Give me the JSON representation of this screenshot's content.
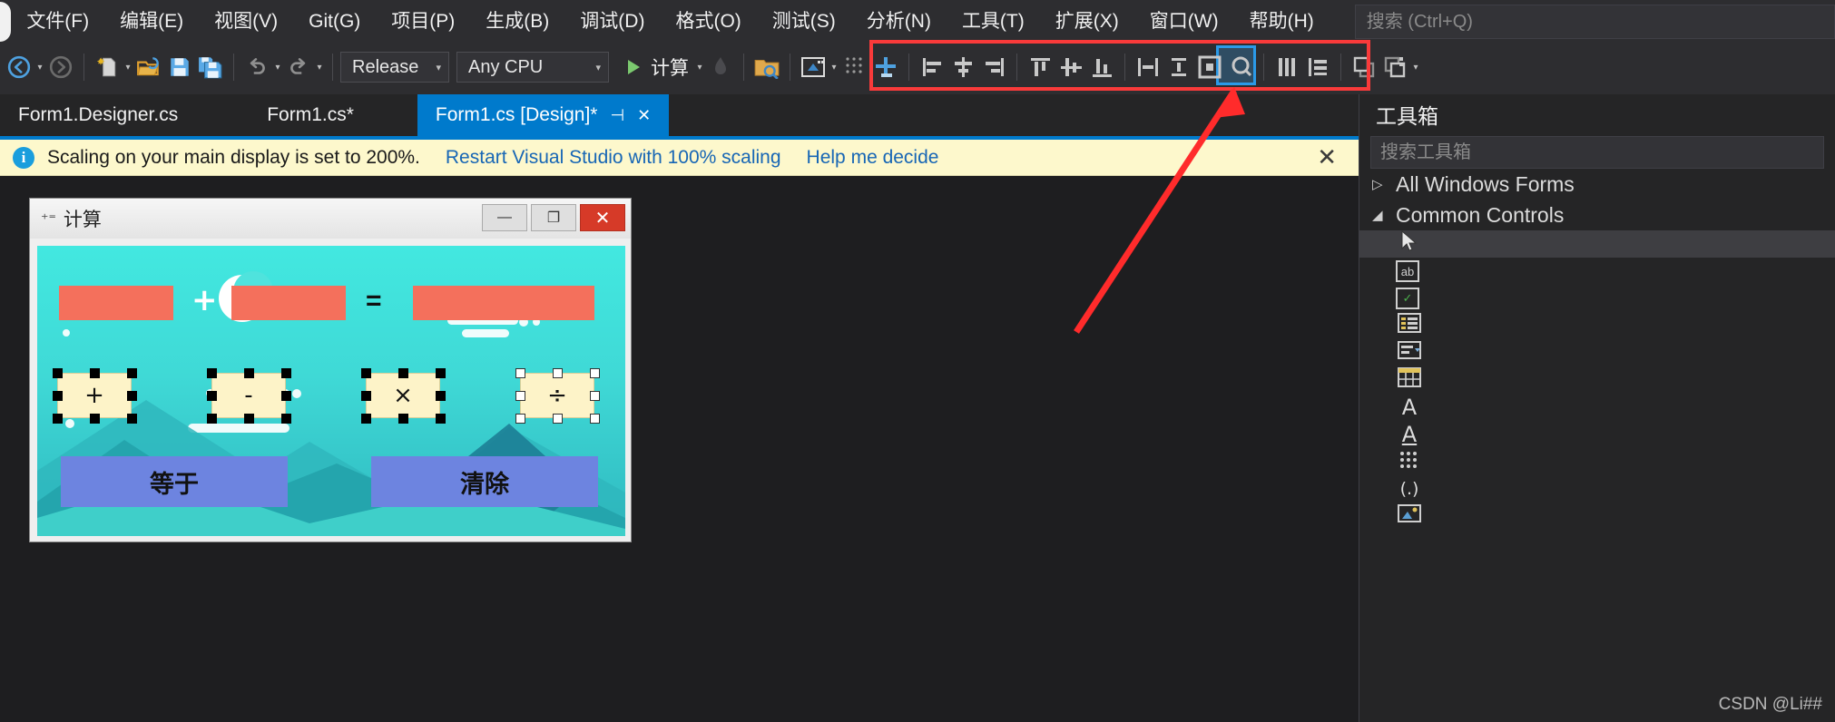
{
  "menubar": {
    "items": [
      {
        "label": "文件(F)",
        "accel": "F"
      },
      {
        "label": "编辑(E)",
        "accel": "E"
      },
      {
        "label": "视图(V)",
        "accel": "V"
      },
      {
        "label": "Git(G)",
        "accel": "G"
      },
      {
        "label": "项目(P)",
        "accel": "P"
      },
      {
        "label": "生成(B)",
        "accel": "B"
      },
      {
        "label": "调试(D)",
        "accel": "D"
      },
      {
        "label": "格式(O)",
        "accel": "O"
      },
      {
        "label": "测试(S)",
        "accel": "S"
      },
      {
        "label": "分析(N)",
        "accel": "N"
      },
      {
        "label": "工具(T)",
        "accel": "T"
      },
      {
        "label": "扩展(X)",
        "accel": "X"
      },
      {
        "label": "窗口(W)",
        "accel": "W"
      },
      {
        "label": "帮助(H)",
        "accel": "H"
      }
    ],
    "search_placeholder": "搜索 (Ctrl+Q)"
  },
  "toolbar": {
    "configuration": "Release",
    "platform": "Any CPU",
    "run_label": "计算",
    "icons": [
      "navigate-back-icon",
      "navigate-forward-icon",
      "new-item-icon",
      "open-file-icon",
      "save-icon",
      "save-all-icon",
      "undo-icon",
      "redo-icon"
    ],
    "align_icons": [
      "align-lefts-icon",
      "align-centers-icon",
      "align-rights-icon",
      "align-tops-icon",
      "align-middles-icon",
      "align-bottoms-icon",
      "make-same-width-icon",
      "make-same-height-icon",
      "make-same-size-icon",
      "size-to-grid-icon",
      "horizontal-spacing-make-equal-icon",
      "vertical-spacing-make-equal-icon",
      "bring-to-front-icon",
      "send-to-back-icon",
      "overflow-chevron-icon"
    ],
    "selected_icon": "horizontal-spacing-make-equal-icon",
    "highlight_color": "#f93a3a",
    "selection_color": "#2b9ae8"
  },
  "tabs": {
    "items": [
      {
        "label": "Form1.Designer.cs",
        "active": false
      },
      {
        "label": "Form1.cs*",
        "active": false
      },
      {
        "label": "Form1.cs [Design]*",
        "active": true
      }
    ],
    "pin_glyph": "⊣",
    "close_glyph": "✕",
    "accent": "#007acc"
  },
  "infobar": {
    "icon": "info-icon",
    "message": "Scaling on your main display is set to 200%.",
    "link_restart": "Restart Visual Studio with 100% scaling",
    "link_help": "Help me decide",
    "close_glyph": "✕",
    "background": "#fdf8cc"
  },
  "form": {
    "title": "计算",
    "title_icon": "calculator-icon",
    "minimize_glyph": "—",
    "maximize_glyph": "❐",
    "close_glyph": "✕",
    "operand_boxes": [
      "",
      ""
    ],
    "result_box": "",
    "plus_label": "+",
    "equals_label": "=",
    "operator_buttons": [
      {
        "label": "+",
        "selected": true,
        "handles": "filled"
      },
      {
        "label": "-",
        "selected": true,
        "handles": "filled"
      },
      {
        "label": "×",
        "selected": true,
        "handles": "filled"
      },
      {
        "label": "÷",
        "selected": true,
        "handles": "open"
      }
    ],
    "action_buttons": [
      {
        "label": "等于"
      },
      {
        "label": "清除"
      }
    ]
  },
  "toolbox": {
    "title": "工具箱",
    "search_placeholder": "搜索工具箱",
    "nodes": [
      {
        "label": "All Windows Forms",
        "expanded": false,
        "arrow": "▷"
      },
      {
        "label": "Common Controls",
        "expanded": true,
        "arrow": "◢"
      }
    ],
    "items": [
      {
        "name": "pointer-icon",
        "glyph": "➤",
        "selected": true
      },
      {
        "name": "textbox-icon",
        "glyph": "ab",
        "selected": false
      },
      {
        "name": "checkbox-icon",
        "glyph": "✓",
        "selected": false
      },
      {
        "name": "listbox-icon",
        "glyph": "≣",
        "selected": false
      },
      {
        "name": "combobox-icon",
        "glyph": "▤",
        "selected": false
      },
      {
        "name": "datagridview-icon",
        "glyph": "▦",
        "selected": false
      },
      {
        "name": "label-icon",
        "glyph": "A",
        "selected": false
      },
      {
        "name": "linklabel-icon",
        "glyph": "A",
        "selected": false
      },
      {
        "name": "maskedtextbox-icon",
        "glyph": "⠿",
        "selected": false
      },
      {
        "name": "numericupdown-icon",
        "glyph": "(.)",
        "selected": false
      },
      {
        "name": "picturebox-icon",
        "glyph": "▨",
        "selected": false
      }
    ]
  },
  "watermark": "CSDN @Li##"
}
